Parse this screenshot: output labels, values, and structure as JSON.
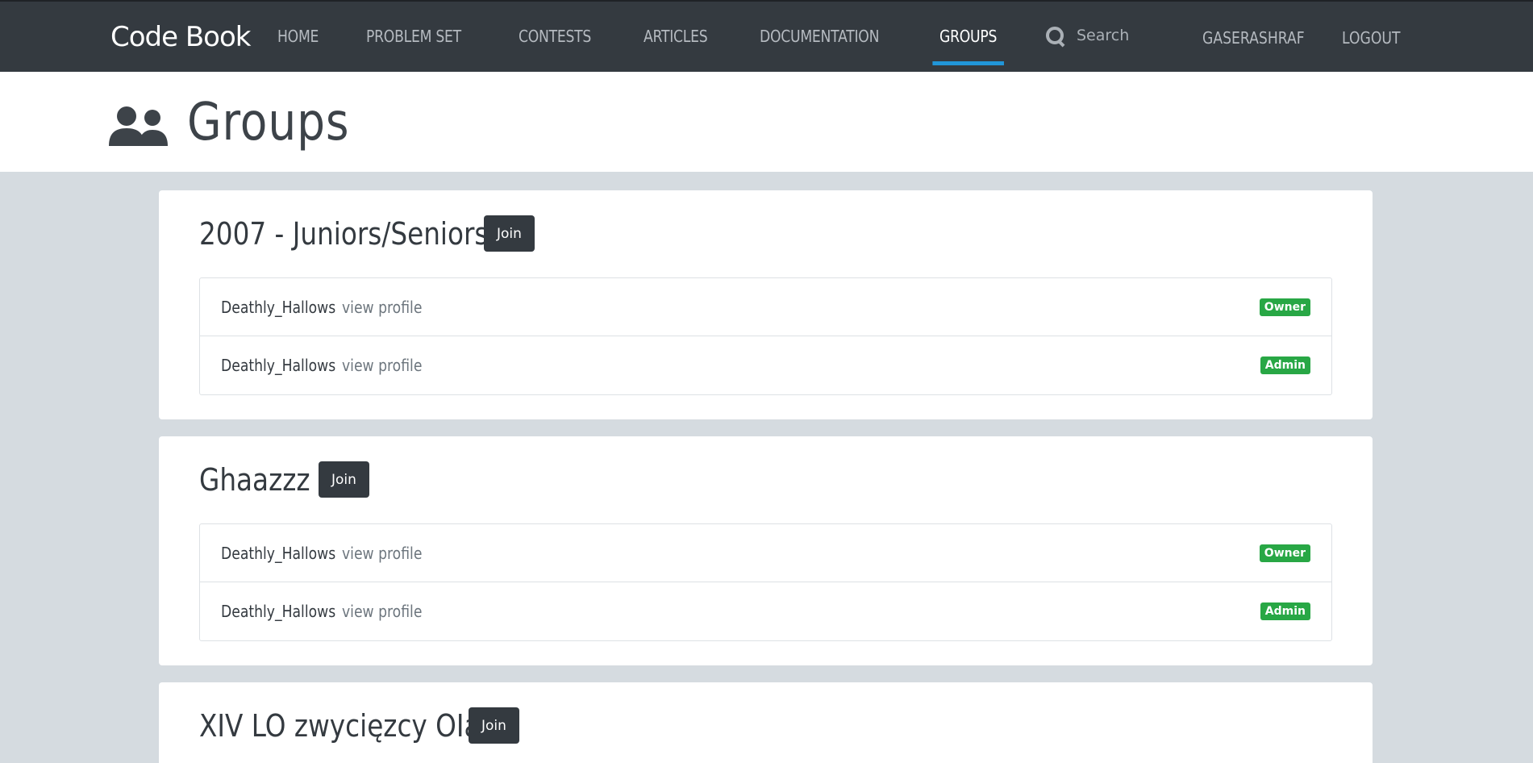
{
  "navbar": {
    "brand": "Code Book",
    "links": [
      {
        "label": "HOME",
        "active": false
      },
      {
        "label": "PROBLEM SET",
        "active": false
      },
      {
        "label": "CONTESTS",
        "active": false
      },
      {
        "label": "ARTICLES",
        "active": false
      },
      {
        "label": "DOCUMENTATION",
        "active": false
      },
      {
        "label": "GROUPS",
        "active": true
      }
    ],
    "search_placeholder": "Search",
    "user": "GASERASHRAF",
    "logout": "LOGOUT"
  },
  "header": {
    "title": "Groups",
    "icon": "users-icon"
  },
  "groups": [
    {
      "name": "2007 - Juniors/Seniors",
      "join_label": "Join",
      "members": [
        {
          "name": "Deathly_Hallows",
          "link": "view profile",
          "role": "Owner"
        },
        {
          "name": "Deathly_Hallows",
          "link": "view profile",
          "role": "Admin"
        }
      ]
    },
    {
      "name": "Ghaazzz",
      "join_label": "Join",
      "members": [
        {
          "name": "Deathly_Hallows",
          "link": "view profile",
          "role": "Owner"
        },
        {
          "name": "Deathly_Hallows",
          "link": "view profile",
          "role": "Admin"
        }
      ]
    },
    {
      "name": "XIV LO zwycięzcy OIa",
      "join_label": "Join",
      "members": []
    }
  ],
  "colors": {
    "navbar_bg": "#343a40",
    "active_underline": "#2196d9",
    "badge_green": "#28a745",
    "page_bg": "#d5dbe0"
  }
}
